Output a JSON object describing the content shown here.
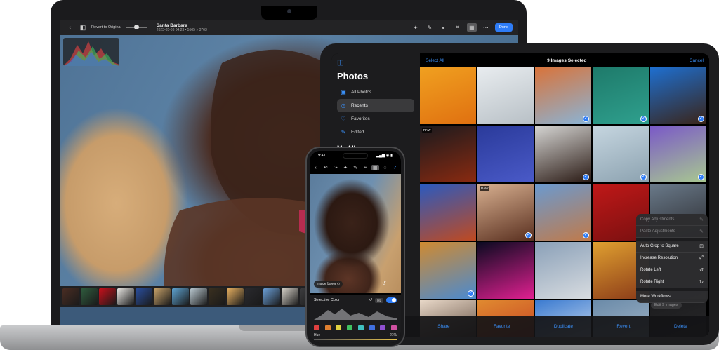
{
  "mac": {
    "toolbar": {
      "back_glyph": "‹",
      "view_glyph": "◧",
      "revert_label": "Revert to Original",
      "title": "Santa Barbara",
      "subtitle": "2023-05-03 04:23 • 5505 × 3763",
      "done_label": "Done",
      "tools": [
        "magic-wand-icon",
        "brush-icon",
        "mask-icon",
        "crop-icon",
        "adjust-icon",
        "more-icon"
      ]
    },
    "filmstrip_colors": [
      "#4a2d23",
      "#2f5c3e",
      "#c8101b",
      "#e8e6e2",
      "#2a4fa0",
      "#c9a36a",
      "#5ea3d1",
      "#b8c7cf",
      "#3a3020",
      "#e8b060",
      "#2a2a2e",
      "#6a9fd8",
      "#d6d1c8",
      "#3c3c3e",
      "#7a4a32",
      "#4a7ec0"
    ]
  },
  "ipad": {
    "sidebar": {
      "title": "Photos",
      "items": [
        {
          "label": "All Photos",
          "icon": "photo-stack-icon",
          "glyph": "▣"
        },
        {
          "label": "Recents",
          "icon": "clock-icon",
          "glyph": "◷"
        },
        {
          "label": "Favorites",
          "icon": "heart-icon",
          "glyph": "♡"
        },
        {
          "label": "Edited",
          "icon": "edit-icon",
          "glyph": "✎"
        }
      ],
      "section": "My Albums"
    },
    "topbar": {
      "left": "Select All",
      "center": "9 Images Selected",
      "right": "Cancel"
    },
    "grid": [
      {
        "c1": "#f0a020",
        "c2": "#e07010",
        "check": false,
        "raw": false
      },
      {
        "c1": "#e8ecef",
        "c2": "#b8c0c6",
        "check": false,
        "raw": false
      },
      {
        "c1": "#d9733a",
        "c2": "#8ab4d6",
        "check": true,
        "raw": false
      },
      {
        "c1": "#1e7a6a",
        "c2": "#2fa08e",
        "check": true,
        "raw": false
      },
      {
        "c1": "#1e6fd0",
        "c2": "#3a2418",
        "check": true,
        "raw": false
      },
      {
        "c1": "#1a1a1e",
        "c2": "#8a2a10",
        "check": false,
        "raw": true
      },
      {
        "c1": "#2a3a9a",
        "c2": "#4a5ac8",
        "check": false,
        "raw": false
      },
      {
        "c1": "#d6d6d4",
        "c2": "#2a1a14",
        "check": true,
        "raw": false
      },
      {
        "c1": "#c6d6e0",
        "c2": "#8ca2b0",
        "check": true,
        "raw": false
      },
      {
        "c1": "#7a58c8",
        "c2": "#a8c890",
        "check": true,
        "raw": false
      },
      {
        "c1": "#2a5ac0",
        "c2": "#c04a20",
        "check": false,
        "raw": false
      },
      {
        "c1": "#d8b090",
        "c2": "#5a3020",
        "check": true,
        "raw": true
      },
      {
        "c1": "#6a9ad0",
        "c2": "#c07a4a",
        "check": true,
        "raw": false
      },
      {
        "c1": "#c01818",
        "c2": "#7a1010",
        "check": false,
        "raw": false
      },
      {
        "c1": "#6a7a8a",
        "c2": "#2a2a2e",
        "check": false,
        "raw": false
      },
      {
        "c1": "#d08a30",
        "c2": "#4a8ad0",
        "check": true,
        "raw": false
      },
      {
        "c1": "#0a0a20",
        "c2": "#e02090",
        "check": false,
        "raw": false
      },
      {
        "c1": "#8aa0b8",
        "c2": "#d8dce0",
        "check": false,
        "raw": false
      },
      {
        "c1": "#e0a030",
        "c2": "#8a3a18",
        "check": false,
        "raw": false
      },
      {
        "c1": "#2a2a2e",
        "c2": "#3a3a3c",
        "check": false,
        "raw": false
      },
      {
        "c1": "#e8d8c8",
        "c2": "#3a2418",
        "check": false,
        "raw": false
      },
      {
        "c1": "#e08a30",
        "c2": "#c03020",
        "check": false,
        "raw": false
      },
      {
        "c1": "#3a7ad0",
        "c2": "#eef2f6",
        "check": false,
        "raw": false
      },
      {
        "c1": "#6a8aa8",
        "c2": "#b0c0d0",
        "check": false,
        "raw": false
      },
      {
        "c1": "#1c1c1e",
        "c2": "#2c2c2e",
        "check": false,
        "raw": false
      }
    ],
    "raw_label": "RAW",
    "check_glyph": "✓",
    "menu": {
      "group1": [
        {
          "label": "Copy Adjustments",
          "glyph": "✎",
          "disabled": true
        },
        {
          "label": "Paste Adjustments",
          "glyph": "✎",
          "disabled": true
        }
      ],
      "group2": [
        {
          "label": "Auto Crop to Square",
          "glyph": "⊡",
          "disabled": false
        },
        {
          "label": "Increase Resolution",
          "glyph": "⤢",
          "disabled": false
        },
        {
          "label": "Rotate Left",
          "glyph": "↺",
          "disabled": false
        },
        {
          "label": "Rotate Right",
          "glyph": "↻",
          "disabled": false
        }
      ],
      "group3": [
        {
          "label": "More Workflows...",
          "glyph": "",
          "disabled": false
        }
      ]
    },
    "edit_button": "Edit 9 Images",
    "bottombar": {
      "share": "Share",
      "favorite": "Favorite",
      "duplicate": "Duplicate",
      "revert": "Revert",
      "delete": "Delete"
    }
  },
  "iphone": {
    "status": {
      "time": "9:41",
      "indicators": "▂▄▆ ◉ ▮"
    },
    "toolbar": [
      {
        "glyph": "‹",
        "name": "back-icon",
        "style": ""
      },
      {
        "glyph": "↶",
        "name": "undo-icon",
        "style": ""
      },
      {
        "glyph": "↷",
        "name": "redo-icon",
        "style": ""
      },
      {
        "glyph": "✦",
        "name": "magic-wand-icon",
        "style": ""
      },
      {
        "glyph": "✎",
        "name": "brush-icon",
        "style": ""
      },
      {
        "glyph": "⌗",
        "name": "crop-icon",
        "style": ""
      },
      {
        "glyph": "▦",
        "name": "adjust-icon",
        "style": "sel"
      },
      {
        "glyph": "◌",
        "name": "more-icon",
        "style": ""
      },
      {
        "glyph": "✓",
        "name": "done-icon",
        "style": "blue"
      }
    ],
    "layer_label": "Image Layer ◇",
    "undo_glyph": "↺",
    "panel": {
      "title": "Selective Color",
      "reset_glyph": "↺",
      "chip": "HL",
      "swatches": [
        "#e04040",
        "#e08030",
        "#e0d040",
        "#40c060",
        "#40c0c0",
        "#4070e0",
        "#9050d0",
        "#d050a0"
      ],
      "hue_label": "Hue",
      "value": "21%"
    }
  }
}
